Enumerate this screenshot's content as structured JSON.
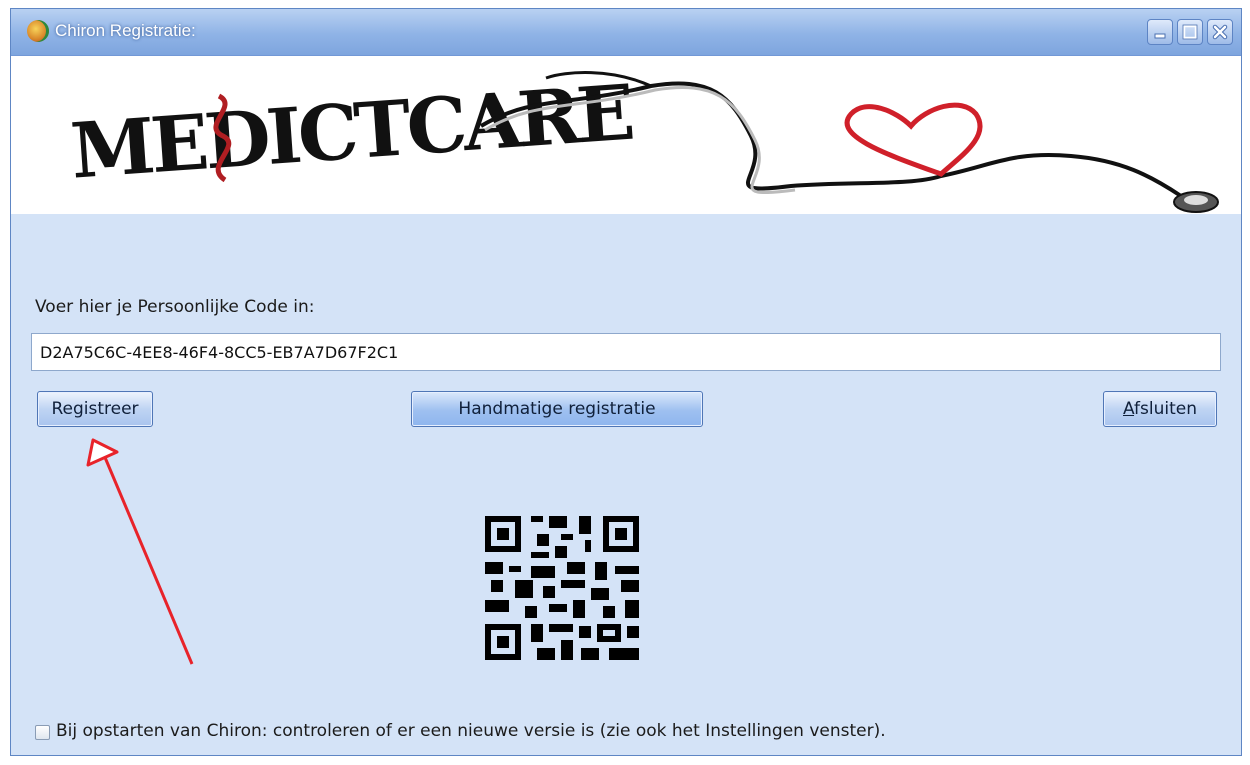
{
  "window": {
    "title": "Chiron Registratie:"
  },
  "banner": {
    "logo_text": "MEDICTCARE"
  },
  "registration": {
    "prompt_label": "Voer hier je Persoonlijke Code in:",
    "code_value": "D2A75C6C-4EE8-46F4-8CC5-EB7A7D67F2C1"
  },
  "buttons": {
    "register": "Registreer",
    "manual": "Handmatige registratie",
    "close_prefix": "A",
    "close_rest": "fsluiten"
  },
  "update_check": {
    "label": "Bij opstarten van Chiron: controleren of er een nieuwe versie is (zie ook het Instellingen venster).",
    "checked": false
  },
  "colors": {
    "window_bg": "#d4e3f7",
    "titlebar": "#8fb3e6",
    "annotation_arrow": "#e8232a",
    "heart": "#d0202a"
  },
  "icons": [
    "app-icon",
    "minimize-icon",
    "maximize-icon",
    "close-icon",
    "qr-code-icon",
    "stethoscope-icon"
  ]
}
